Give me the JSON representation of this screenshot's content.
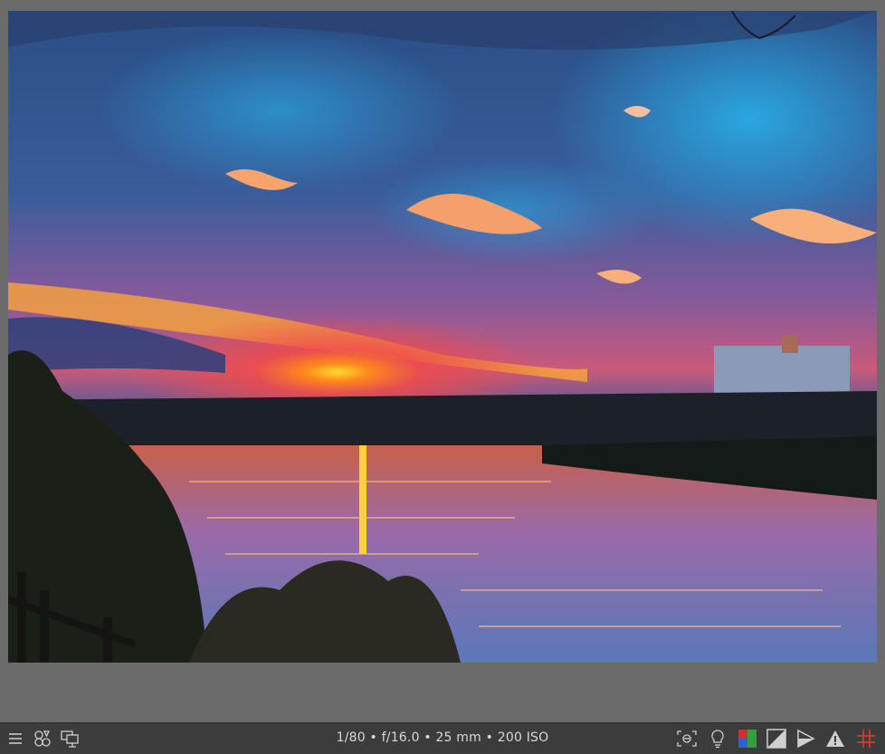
{
  "viewer": {
    "image_content": "sunset-over-pond-photo"
  },
  "bottombar": {
    "exif_line": "1/80 • f/16.0 • 25 mm • 200 ISO",
    "left_icons": [
      "menu-icon",
      "styles-icon",
      "display-profile-icon"
    ],
    "right_icons": [
      "focus-peaking-icon",
      "color-assessment-icon",
      "softproof-icon",
      "clipping-icon",
      "gamut-check-icon",
      "overexposed-warning-icon",
      "guides-icon"
    ],
    "colors": {
      "bar_bg": "#3c3c3c",
      "icon": "#cfcfcf",
      "guides_accent": "#e0402a"
    }
  }
}
